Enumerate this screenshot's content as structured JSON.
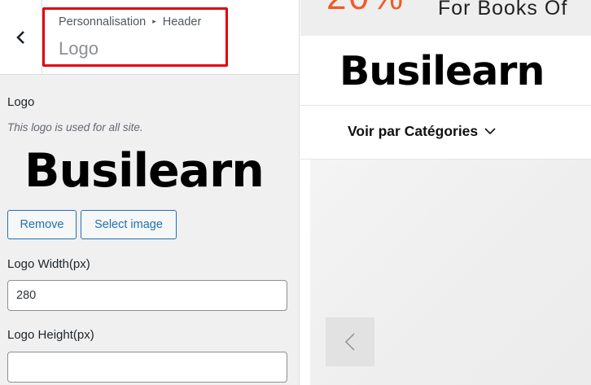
{
  "panel": {
    "breadcrumb": {
      "parent": "Personnalisation",
      "separator": "▸",
      "current": "Header"
    },
    "title": "Logo",
    "logo_section": {
      "label": "Logo",
      "description": "This logo is used for all site.",
      "preview_text": "Busilearn",
      "remove_label": "Remove",
      "select_label": "Select image"
    },
    "width_field": {
      "label": "Logo Width(px)",
      "value": "280"
    },
    "height_field": {
      "label": "Logo Height(px)",
      "value": ""
    }
  },
  "preview": {
    "promo": {
      "percent": "20%",
      "text": "For Books Of"
    },
    "site_logo": "Busilearn",
    "category_nav": "Voir par Catégories"
  },
  "colors": {
    "highlight": "#e3000b",
    "accent": "#2271b1",
    "promo_orange": "#f05a28"
  },
  "icons": [
    "chevron-left-icon",
    "chevron-down-icon",
    "slider-prev-icon"
  ]
}
